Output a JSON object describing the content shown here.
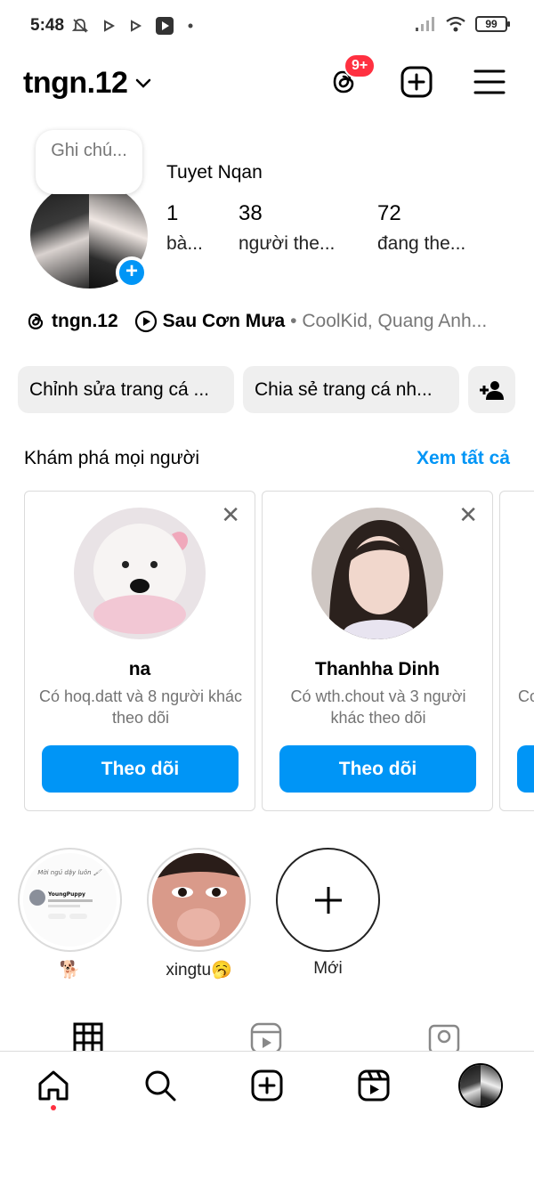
{
  "status_bar": {
    "time": "5:48",
    "battery": "99"
  },
  "header": {
    "username": "tngn.12",
    "notification_badge": "9+"
  },
  "profile": {
    "note_placeholder": "Ghi chú...",
    "display_name": "Tuyet Nqan",
    "stats": [
      {
        "count": "1",
        "label": "bà..."
      },
      {
        "count": "38",
        "label": "người the..."
      },
      {
        "count": "72",
        "label": "đang the..."
      }
    ]
  },
  "links": {
    "threads_handle": "tngn.12",
    "song_title": "Sau Cơn Mưa",
    "song_artists": "• CoolKid, Quang Anh..."
  },
  "actions": {
    "edit_profile": "Chỉnh sửa trang cá ...",
    "share_profile": "Chia sẻ trang cá nh..."
  },
  "discover": {
    "title": "Khám phá mọi người",
    "see_all": "Xem tất cả",
    "cards": [
      {
        "name": "na",
        "subtitle": "Có hoq.datt và 8 người khác theo dõi",
        "follow_label": "Theo dõi"
      },
      {
        "name": "Thanhha Dinh",
        "subtitle": "Có wth.chout và 3 người khác theo dõi",
        "follow_label": "Theo dõi"
      },
      {
        "name": "",
        "subtitle": "Co",
        "follow_label": ""
      }
    ]
  },
  "highlights": [
    {
      "label": "🐕",
      "preview_title": "Mời ngủ dậy luôn 🖌",
      "preview_user": "YoungPuppy"
    },
    {
      "label": "xingtu🥱"
    },
    {
      "label": "Mới"
    }
  ],
  "colors": {
    "accent": "#0095f6",
    "badge": "#ff3040"
  }
}
